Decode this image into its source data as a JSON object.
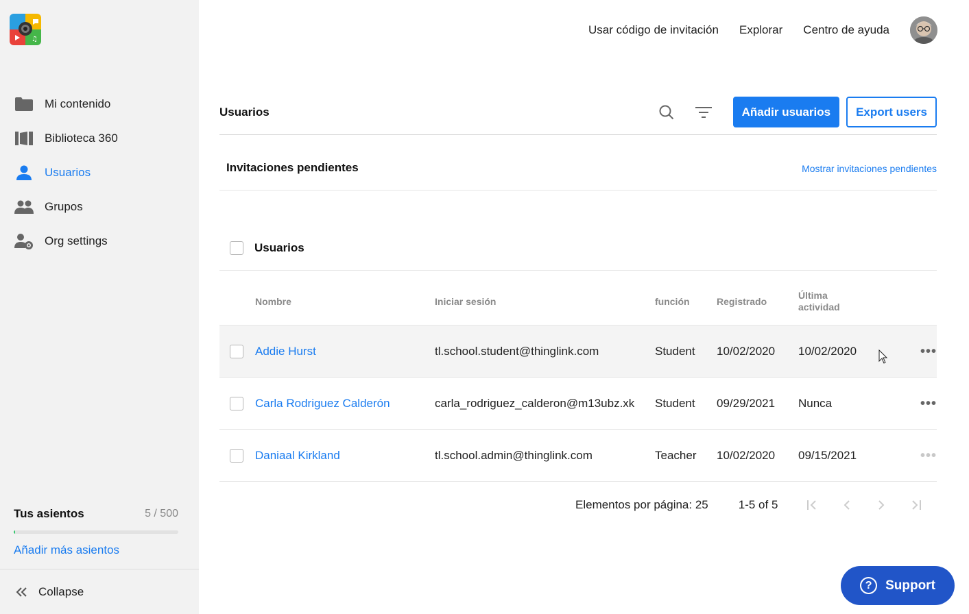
{
  "sidebar": {
    "items": [
      {
        "label": "Mi contenido",
        "icon": "folder-icon"
      },
      {
        "label": "Biblioteca 360",
        "icon": "library-icon"
      },
      {
        "label": "Usuarios",
        "icon": "user-icon",
        "active": true
      },
      {
        "label": "Grupos",
        "icon": "group-icon"
      },
      {
        "label": "Org settings",
        "icon": "user-gear-icon"
      }
    ],
    "seats": {
      "title": "Tus asientos",
      "count": "5 / 500",
      "fraction": 0.01,
      "link": "Añadir más asientos"
    },
    "collapse": "Collapse"
  },
  "topnav": {
    "invite": "Usar código de invitación",
    "explore": "Explorar",
    "help": "Centro de ayuda"
  },
  "header": {
    "title": "Usuarios",
    "add_button": "Añadir usuarios",
    "export_button": "Export users"
  },
  "pending": {
    "title": "Invitaciones pendientes",
    "link": "Mostrar invitaciones pendientes"
  },
  "users_section": {
    "title": "Usuarios"
  },
  "table": {
    "columns": {
      "name": "Nombre",
      "login": "Iniciar sesión",
      "role": "función",
      "registered": "Registrado",
      "last_activity_1": "Última",
      "last_activity_2": "actividad"
    },
    "rows": [
      {
        "name": "Addie Hurst",
        "login": "tl.school.student@thinglink.com",
        "role": "Student",
        "registered": "10/02/2020",
        "last": "10/02/2020"
      },
      {
        "name": "Carla Rodriguez Calderón",
        "login": "carla_rodriguez_calderon@m13ubz.xk",
        "role": "Student",
        "registered": "09/29/2021",
        "last": "Nunca"
      },
      {
        "name": "Daniaal Kirkland",
        "login": "tl.school.admin@thinglink.com",
        "role": "Teacher",
        "registered": "10/02/2020",
        "last": "09/15/2021"
      }
    ]
  },
  "pager": {
    "per_page": "Elementos por página: 25",
    "range": "1-5 of 5"
  },
  "support": {
    "label": "Support"
  },
  "colors": {
    "accent": "#1a7cf0",
    "support": "#2155c8",
    "seats_fill": "#2ec66a"
  }
}
